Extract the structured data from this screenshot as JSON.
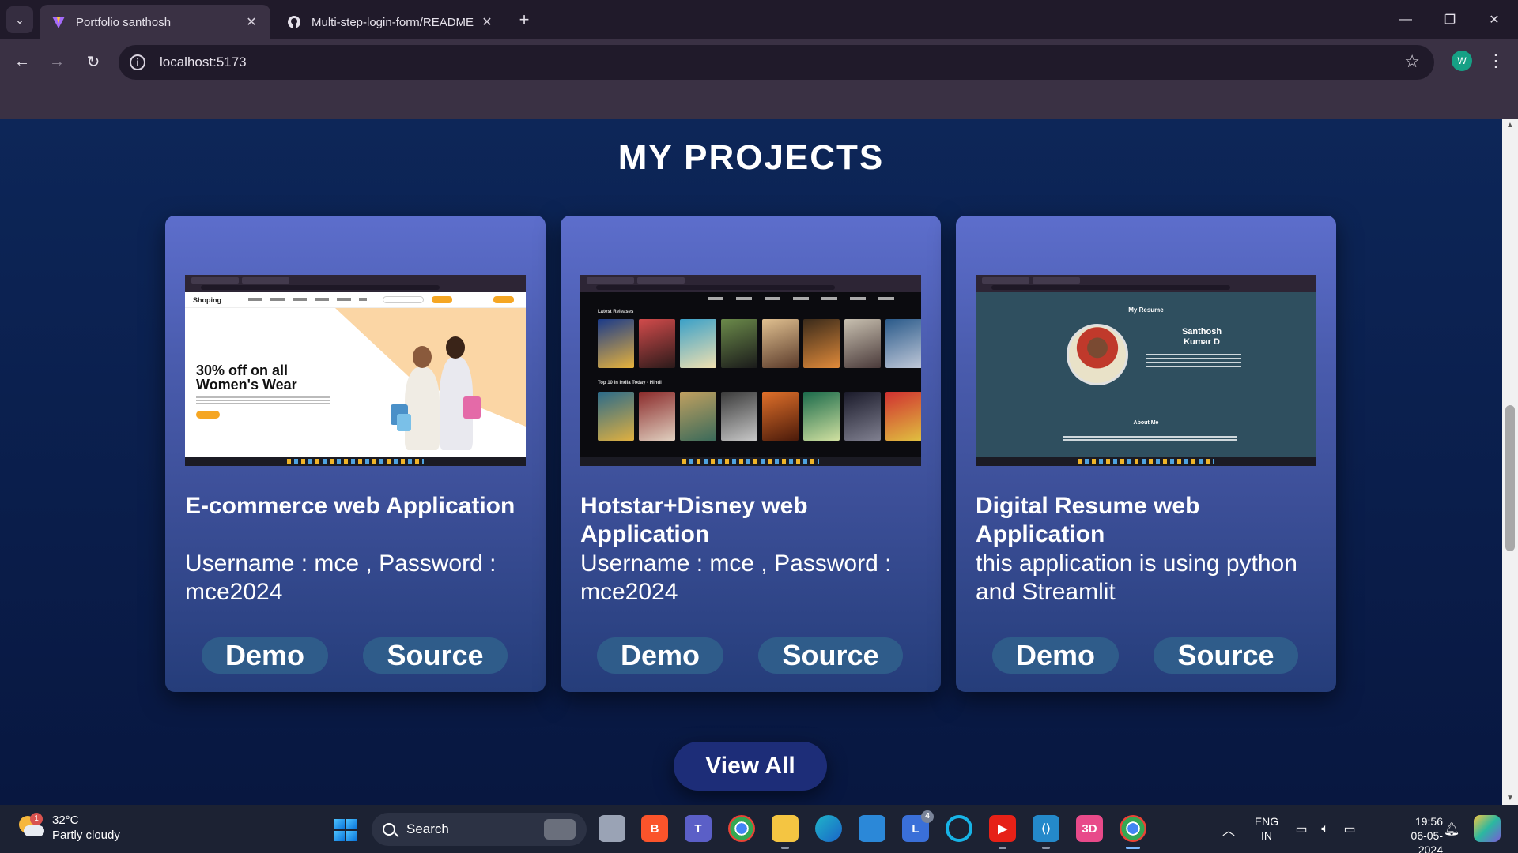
{
  "browser": {
    "tabs": [
      {
        "title": "Portfolio santhosh",
        "active": true
      },
      {
        "title": "Multi-step-login-form/README",
        "active": false
      }
    ],
    "url": "localhost:5173",
    "profile_initial": "W"
  },
  "page": {
    "section_title": "MY PROJECTS",
    "projects": [
      {
        "title": "E-commerce web Application",
        "description": "Username : mce , Password : mce2024",
        "demo_label": "Demo",
        "source_label": "Source",
        "thumbnail": {
          "brand": "Shoping",
          "headline_line1": "30% off on all",
          "headline_line2": "Women's Wear"
        }
      },
      {
        "title": "Hotstar+Disney web Application",
        "description": "Username : mce , Password : mce2024",
        "demo_label": "Demo",
        "source_label": "Source",
        "thumbnail": {
          "row1_label": "Latest Releases",
          "row2_label": "Top 10 in India Today - Hindi"
        }
      },
      {
        "title": "Digital Resume web Application",
        "description": "this application is using python and Streamlit",
        "demo_label": "Demo",
        "source_label": "Source",
        "thumbnail": {
          "heading": "My Resume",
          "name_line1": "Santhosh",
          "name_line2": "Kumar D",
          "about": "About Me"
        }
      }
    ],
    "view_all_label": "View All"
  },
  "taskbar": {
    "weather": {
      "temp": "32°C",
      "condition": "Partly cloudy",
      "badge": "1"
    },
    "search_placeholder": "Search",
    "apps": [
      {
        "name": "task-view",
        "color": "#9aa3b5"
      },
      {
        "name": "brave",
        "color": "#fb542b"
      },
      {
        "name": "teams",
        "color": "#5b5fc7"
      },
      {
        "name": "chrome",
        "color": "#34a853"
      },
      {
        "name": "file-explorer",
        "color": "#f4c542"
      },
      {
        "name": "edge",
        "color": "#1fb5c9"
      },
      {
        "name": "microsoft-store",
        "color": "#2b88d8"
      },
      {
        "name": "classroom-l",
        "color": "#3a6fd8",
        "badge": "4"
      },
      {
        "name": "cortana",
        "color": "#17b3e6"
      },
      {
        "name": "youtube",
        "color": "#e62117"
      },
      {
        "name": "vscode",
        "color": "#2489ca"
      },
      {
        "name": "3d-app",
        "color": "#e84a8a"
      },
      {
        "name": "chrome-active",
        "color": "#34a853"
      }
    ],
    "lang_line1": "ENG",
    "lang_line2": "IN",
    "time": "19:56",
    "date": "06-05-2024"
  }
}
